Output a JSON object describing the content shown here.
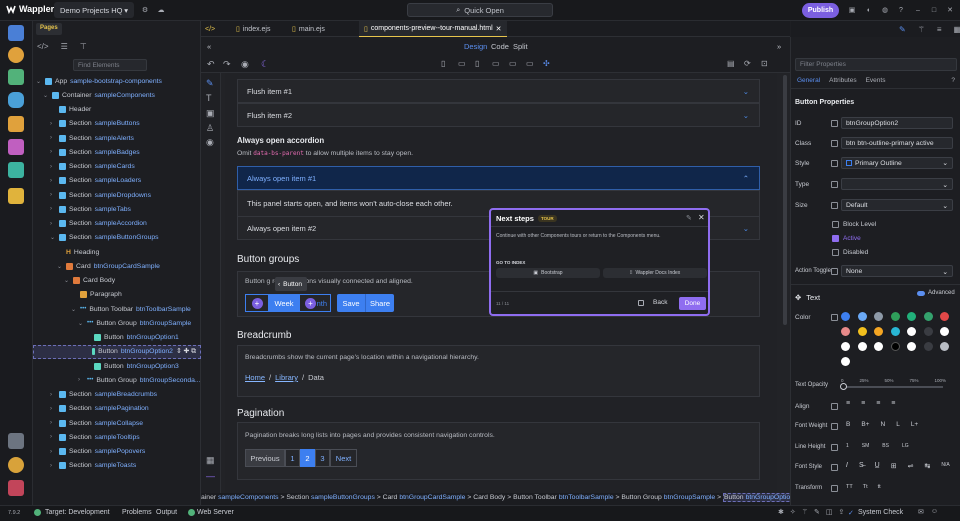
{
  "app": {
    "name": "Wappler",
    "project": "Demo Projects HQ",
    "quick_open": "Quick Open",
    "publish": "Publish"
  },
  "left_panel": {
    "tabs": [
      "Pages"
    ],
    "find_placeholder": "Find Elements",
    "tree": [
      {
        "label": "App",
        "name": "sample-bootstrap-components",
        "depth": 0,
        "icon": "app"
      },
      {
        "label": "Container",
        "name": "sampleComponents",
        "depth": 1,
        "icon": "container"
      },
      {
        "label": "Header",
        "name": "",
        "depth": 2,
        "icon": "section"
      },
      {
        "label": "Section",
        "name": "sampleButtons",
        "depth": 2,
        "icon": "section"
      },
      {
        "label": "Section",
        "name": "sampleAlerts",
        "depth": 2,
        "icon": "section"
      },
      {
        "label": "Section",
        "name": "sampleBadges",
        "depth": 2,
        "icon": "section"
      },
      {
        "label": "Section",
        "name": "sampleCards",
        "depth": 2,
        "icon": "section"
      },
      {
        "label": "Section",
        "name": "sampleLoaders",
        "depth": 2,
        "icon": "section"
      },
      {
        "label": "Section",
        "name": "sampleDropdowns",
        "depth": 2,
        "icon": "section"
      },
      {
        "label": "Section",
        "name": "sampleTabs",
        "depth": 2,
        "icon": "section"
      },
      {
        "label": "Section",
        "name": "sampleAccordion",
        "depth": 2,
        "icon": "section"
      },
      {
        "label": "Section",
        "name": "sampleButtonGroups",
        "depth": 2,
        "icon": "section"
      },
      {
        "label": "Heading",
        "name": "",
        "depth": 3,
        "icon": "heading"
      },
      {
        "label": "Card",
        "name": "btnGroupCardSample",
        "depth": 3,
        "icon": "card"
      },
      {
        "label": "Card Body",
        "name": "",
        "depth": 4,
        "icon": "card"
      },
      {
        "label": "Paragraph",
        "name": "",
        "depth": 5,
        "icon": "paragraph"
      },
      {
        "label": "Button Toolbar",
        "name": "btnToolbarSample",
        "depth": 5,
        "icon": "dots"
      },
      {
        "label": "Button Group",
        "name": "btnGroupSample",
        "depth": 6,
        "icon": "dots"
      },
      {
        "label": "Button",
        "name": "btnGroupOption1",
        "depth": 7,
        "icon": "button"
      },
      {
        "label": "Button",
        "name": "btnGroupOption2",
        "depth": 7,
        "icon": "button"
      },
      {
        "label": "Button",
        "name": "btnGroupOption3",
        "depth": 7,
        "icon": "button"
      },
      {
        "label": "Button Group",
        "name": "btnGroupSeconda...",
        "depth": 6,
        "icon": "dots"
      },
      {
        "label": "Section",
        "name": "sampleBreadcrumbs",
        "depth": 2,
        "icon": "section"
      },
      {
        "label": "Section",
        "name": "samplePagination",
        "depth": 2,
        "icon": "section"
      },
      {
        "label": "Section",
        "name": "sampleCollapse",
        "depth": 2,
        "icon": "section"
      },
      {
        "label": "Section",
        "name": "sampleTooltips",
        "depth": 2,
        "icon": "section"
      },
      {
        "label": "Section",
        "name": "samplePopovers",
        "depth": 2,
        "icon": "section"
      },
      {
        "label": "Section",
        "name": "sampleToasts",
        "depth": 2,
        "icon": "section"
      }
    ]
  },
  "editor": {
    "tabs": [
      "index.ejs",
      "main.ejs",
      "components-preview--tour-manual.html"
    ],
    "modes": [
      "Design",
      "Code",
      "Split"
    ]
  },
  "page": {
    "flush_1": "Flush item #1",
    "flush_2": "Flush item #2",
    "always_open_title": "Always open accordion",
    "always_open_desc_pre": "Omit",
    "always_open_desc_code": "data-bs-parent",
    "always_open_desc_post": "to allow multiple items to stay open.",
    "ao_item_1": "Always open item #1",
    "ao_body": "This panel starts open, and items won't auto-close each other.",
    "ao_item_2": "Always open item #2",
    "btn_groups_title": "Button groups",
    "btn_groups_desc": "Button g            related actions visually connected and aligned.",
    "btn_group_labels": [
      "Week",
      "nth",
      "Save",
      "Share"
    ],
    "tooltip": "Button",
    "breadcrumb_title": "Breadcrumb",
    "breadcrumb_desc": "Breadcrumbs show the current page's location within a navigational hierarchy.",
    "breadcrumb_items": [
      "Home",
      "Library",
      "Data"
    ],
    "pagination_title": "Pagination",
    "pagination_desc": "Pagination breaks long lists into pages and provides consistent navigation controls.",
    "pagination_items": [
      "Previous",
      "1",
      "2",
      "3",
      "Next"
    ]
  },
  "tour": {
    "title": "Next steps",
    "badge": "TOUR",
    "body": "Continue with other Components tours or return to the Components menu.",
    "goto": "GO TO INDEX",
    "link_1": "Bootstrap",
    "link_2": "Wappler Docs Index",
    "counter": "11 / 11",
    "back": "Back",
    "done": "Done"
  },
  "right_panel": {
    "filter_placeholder": "Filter Properties",
    "tabs": [
      "General",
      "Attributes",
      "Events"
    ],
    "section_title": "Button Properties",
    "id_label": "ID",
    "id_value": "btnGroupOption2",
    "class_label": "Class",
    "class_value": "btn btn-outline-primary active",
    "style_label": "Style",
    "style_value": "Primary Outline",
    "type_label": "Type",
    "type_value": "",
    "size_label": "Size",
    "size_value": "Default",
    "block_level": "Block Level",
    "active": "Active",
    "disabled": "Disabled",
    "action_toggle_label": "Action Toggle",
    "action_toggle_value": "None",
    "text_section": "Text",
    "advanced": "Advanced",
    "color_label": "Color",
    "text_opacity_label": "Text Opacity",
    "opacity_ticks": [
      "0",
      "25%",
      "50%",
      "75%",
      "100%"
    ],
    "align_label": "Align",
    "font_weight_label": "Font Weight",
    "font_weight_opts": [
      "B",
      "B+",
      "N",
      "L",
      "L+"
    ],
    "line_height_label": "Line Height",
    "line_height_opts": [
      "1",
      "SM",
      "BS",
      "LG"
    ],
    "font_style_label": "Font Style",
    "font_style_na": "N/A",
    "transform_label": "Transform",
    "transform_opts": [
      "TT",
      "Tt",
      "tt"
    ],
    "colors": [
      "#3d7ff0",
      "#6aa9f6",
      "#8e9aa8",
      "#2f9e5a",
      "#21b07a",
      "#34a26d",
      "#e24848",
      "#e88a8a",
      "#f2c01e",
      "#f5a623",
      "#29b6d4",
      "#ffffff",
      "#3a3c42",
      "#ffffff",
      "#ffffff",
      "#ffffff",
      "#ffffff",
      "#000000",
      "#ffffff",
      "#3a3c42",
      "#b8bcc4",
      "#ffffff"
    ]
  },
  "breadcrumb_bar": [
    {
      "t": "ainer",
      "n": "sampleComponents"
    },
    {
      "t": "Section",
      "n": "sampleButtonGroups"
    },
    {
      "t": "Card",
      "n": "btnGroupCardSample"
    },
    {
      "t": "Card Body",
      "n": ""
    },
    {
      "t": "Button Toolbar",
      "n": "btnToolbarSample"
    },
    {
      "t": "Button Group",
      "n": "btnGroupSample"
    },
    {
      "t": "Button",
      "n": "btnGroupOption2"
    }
  ],
  "status": {
    "version": "7.9.2",
    "target": "Target: Development",
    "problems": "Problems",
    "output": "Output",
    "web_server": "Web Server",
    "system_check": "System Check"
  }
}
